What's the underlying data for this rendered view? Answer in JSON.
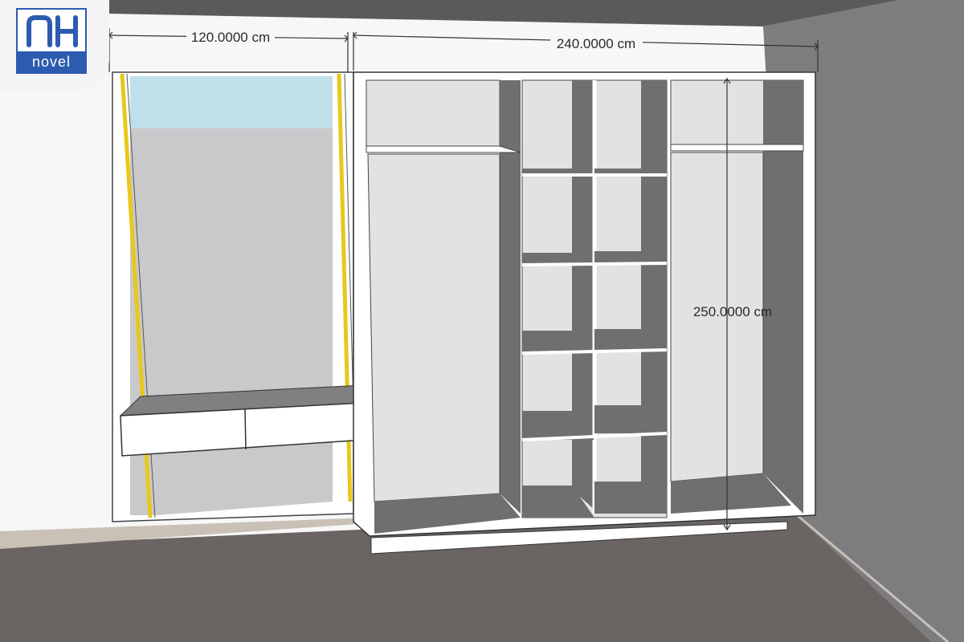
{
  "logo": {
    "mark": "NH",
    "word": "novel",
    "brand_color": "#2d5bb0"
  },
  "dimensions": {
    "left_width": "120.0000 cm",
    "wardrobe_width": "240.0000 cm",
    "wardrobe_height": "250.0000 cm"
  },
  "colors": {
    "ceiling": "#5a5a5c",
    "right_wall": "#7d7d80",
    "floor": "#6a6563",
    "interior_dark": "#6f6f72",
    "interior_light": "#e2e2e4",
    "accent_strip": "#e8c81a",
    "window_sky": "#bfe0ea"
  }
}
